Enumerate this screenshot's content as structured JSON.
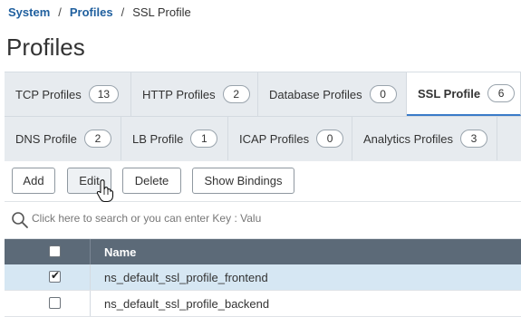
{
  "breadcrumb": {
    "system": "System",
    "sep1": "/",
    "profiles": "Profiles",
    "sep2": "/",
    "current": "SSL Profile"
  },
  "page_title": "Profiles",
  "tabs": [
    {
      "label": "TCP Profiles",
      "count": "13"
    },
    {
      "label": "HTTP Profiles",
      "count": "2"
    },
    {
      "label": "Database Profiles",
      "count": "0"
    },
    {
      "label": "SSL Profile",
      "count": "6",
      "active": true
    },
    {
      "label": "DNS Profile",
      "count": "2"
    },
    {
      "label": "LB Profile",
      "count": "1"
    },
    {
      "label": "ICAP Profiles",
      "count": "0"
    },
    {
      "label": "Analytics Profiles",
      "count": "3"
    }
  ],
  "toolbar": {
    "add": "Add",
    "edit": "Edit",
    "delete": "Delete",
    "show_bindings": "Show Bindings"
  },
  "search": {
    "placeholder": "Click here to search or you can enter Key : Valu",
    "icon": "search-icon"
  },
  "table": {
    "header": {
      "name": "Name"
    },
    "rows": [
      {
        "name": "ns_default_ssl_profile_frontend",
        "checked": true
      },
      {
        "name": "ns_default_ssl_profile_backend",
        "checked": false
      }
    ]
  },
  "colors": {
    "accent": "#3a7bc8",
    "link": "#1f5f9e",
    "header_bg": "#5c6a78",
    "selected_row": "#d6e7f3"
  }
}
